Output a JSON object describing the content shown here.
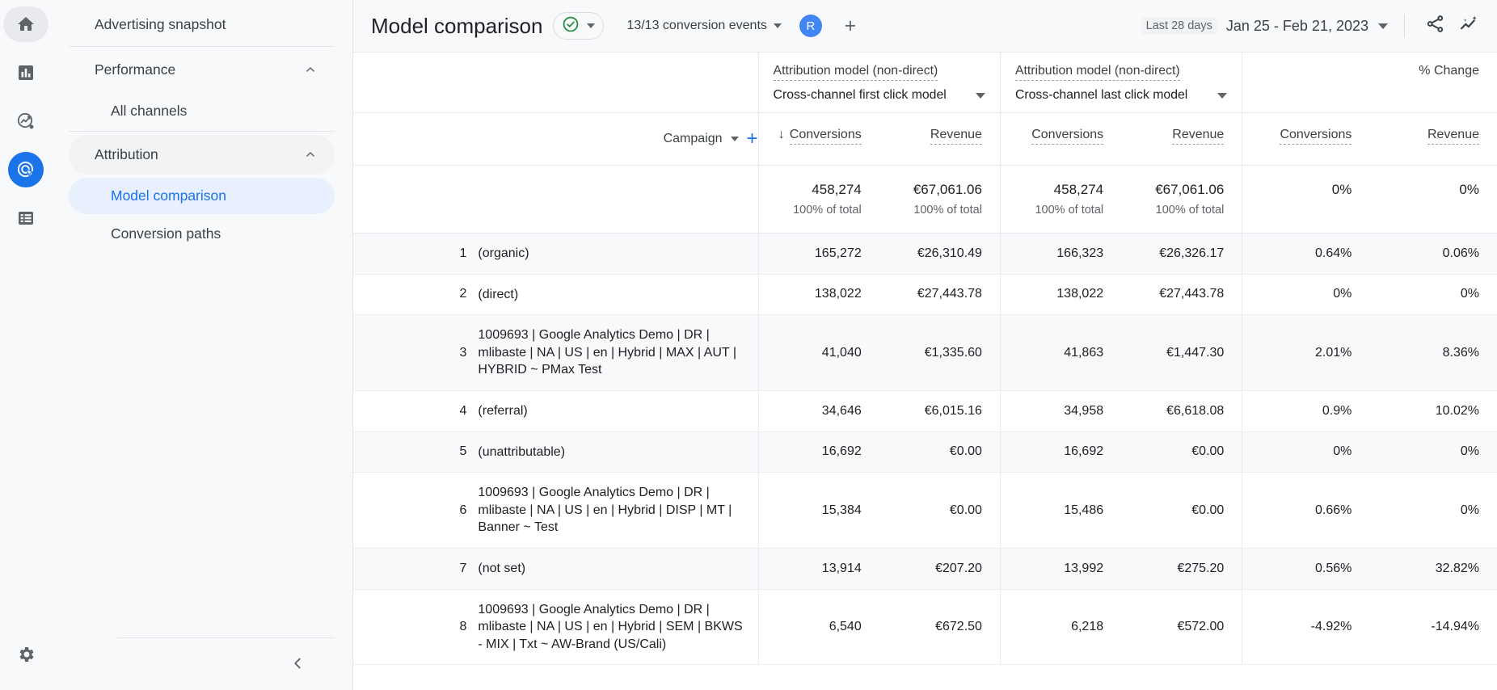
{
  "rail": {
    "icons": [
      {
        "name": "home-icon",
        "label": "Home"
      },
      {
        "name": "reports-bar-chart-icon",
        "label": "Reports"
      },
      {
        "name": "explore-icon",
        "label": "Explore"
      },
      {
        "name": "advertising-target-icon",
        "label": "Advertising"
      },
      {
        "name": "configure-list-icon",
        "label": "Configure"
      },
      {
        "name": "admin-gear-icon",
        "label": "Admin"
      }
    ],
    "accent": "#1a73e8"
  },
  "sidebar": {
    "snapshot_label": "Advertising snapshot",
    "groups": [
      {
        "label": "Performance",
        "expanded": true,
        "items": [
          {
            "label": "All channels",
            "active": false
          }
        ]
      },
      {
        "label": "Attribution",
        "expanded": true,
        "items": [
          {
            "label": "Model comparison",
            "active": true
          },
          {
            "label": "Conversion paths",
            "active": false
          }
        ]
      }
    ],
    "collapse_icon": "chevron-left-icon"
  },
  "header": {
    "title": "Model comparison",
    "status_icon": "check-circle-icon",
    "status_color": "#1e8e3e",
    "events_label": "13/13 conversion events",
    "avatar_initial": "R",
    "add_label": "+",
    "date_badge": "Last 28 days",
    "date_range": "Jan 25 - Feb 21, 2023",
    "share_icon": "share-icon",
    "insights_icon": "insights-sparkline-icon"
  },
  "table": {
    "dimension": {
      "label": "Campaign",
      "add_metric_label": "+"
    },
    "model_groups": [
      {
        "title": "Attribution model (non-direct)",
        "selected": "Cross-channel first click model",
        "metrics": [
          {
            "label": "Conversions",
            "sorted": true,
            "sort_dir": "desc"
          },
          {
            "label": "Revenue",
            "sorted": false
          }
        ]
      },
      {
        "title": "Attribution model (non-direct)",
        "selected": "Cross-channel last click model",
        "metrics": [
          {
            "label": "Conversions",
            "sorted": false
          },
          {
            "label": "Revenue",
            "sorted": false
          }
        ]
      }
    ],
    "change_group": {
      "title": "% Change",
      "metrics": [
        {
          "label": "Conversions"
        },
        {
          "label": "Revenue"
        }
      ]
    },
    "totals": {
      "sub_label": "100% of total",
      "values": [
        "458,274",
        "€67,061.06",
        "458,274",
        "€67,061.06",
        "0%",
        "0%"
      ]
    },
    "rows": [
      {
        "index": "1",
        "dimension": "(organic)",
        "values": [
          "165,272",
          "€26,310.49",
          "166,323",
          "€26,326.17",
          "0.64%",
          "0.06%"
        ]
      },
      {
        "index": "2",
        "dimension": "(direct)",
        "values": [
          "138,022",
          "€27,443.78",
          "138,022",
          "€27,443.78",
          "0%",
          "0%"
        ]
      },
      {
        "index": "3",
        "dimension": "1009693 | Google Analytics Demo | DR | mlibaste | NA | US | en | Hybrid | MAX | AUT | HYBRID ~ PMax Test",
        "values": [
          "41,040",
          "€1,335.60",
          "41,863",
          "€1,447.30",
          "2.01%",
          "8.36%"
        ]
      },
      {
        "index": "4",
        "dimension": "(referral)",
        "values": [
          "34,646",
          "€6,015.16",
          "34,958",
          "€6,618.08",
          "0.9%",
          "10.02%"
        ]
      },
      {
        "index": "5",
        "dimension": "(unattributable)",
        "values": [
          "16,692",
          "€0.00",
          "16,692",
          "€0.00",
          "0%",
          "0%"
        ]
      },
      {
        "index": "6",
        "dimension": "1009693 | Google Analytics Demo | DR | mlibaste | NA | US | en | Hybrid | DISP | MT | Banner ~ Test",
        "values": [
          "15,384",
          "€0.00",
          "15,486",
          "€0.00",
          "0.66%",
          "0%"
        ]
      },
      {
        "index": "7",
        "dimension": "(not set)",
        "values": [
          "13,914",
          "€207.20",
          "13,992",
          "€275.20",
          "0.56%",
          "32.82%"
        ]
      },
      {
        "index": "8",
        "dimension": "1009693 | Google Analytics Demo | DR | mlibaste | NA | US | en | Hybrid | SEM | BKWS - MIX | Txt ~ AW-Brand (US/Cali)",
        "values": [
          "6,540",
          "€672.50",
          "6,218",
          "€572.00",
          "-4.92%",
          "-14.94%"
        ]
      }
    ]
  }
}
